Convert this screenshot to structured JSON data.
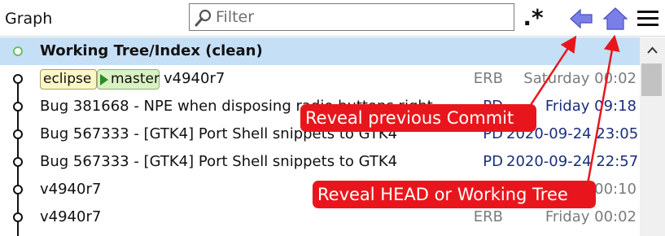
{
  "header": {
    "title": "Graph",
    "filter_placeholder": "Filter",
    "regex_label": ".*"
  },
  "toolbar": {
    "prev_icon": "back-arrow-icon",
    "head_icon": "home-icon",
    "menu_icon": "hamburger-menu-icon"
  },
  "commits": [
    {
      "message": "Working Tree/Index (clean)",
      "author": "",
      "date": ""
    },
    {
      "refs": [
        "eclipse",
        "master"
      ],
      "message": "v4940r7",
      "author": "ERB",
      "date": "Saturday 00:02"
    },
    {
      "message": "Bug 381668 - NPE when disposing radio buttons right",
      "author": "PD",
      "date": "Friday 09:18"
    },
    {
      "message": "Bug 567333 - [GTK4] Port Shell snippets to GTK4",
      "author": "PD",
      "date": "2020-09-24 23:05"
    },
    {
      "message": "Bug 567333 - [GTK4] Port Shell snippets to GTK4",
      "author": "PD",
      "date": "2020-09-24 22:57"
    },
    {
      "message": "v4940r7",
      "author": "",
      "date": "00:10"
    },
    {
      "message": "v4940r7",
      "author": "ERB",
      "date": "Friday 00:02"
    }
  ],
  "callouts": {
    "prev": "Reveal previous Commit",
    "head": "Reveal HEAD or Working Tree"
  },
  "colors": {
    "selection": "#c5dff6",
    "callout": "#e8161c",
    "arrow_button": "#6b6fe0",
    "graph_line": "#111111"
  }
}
